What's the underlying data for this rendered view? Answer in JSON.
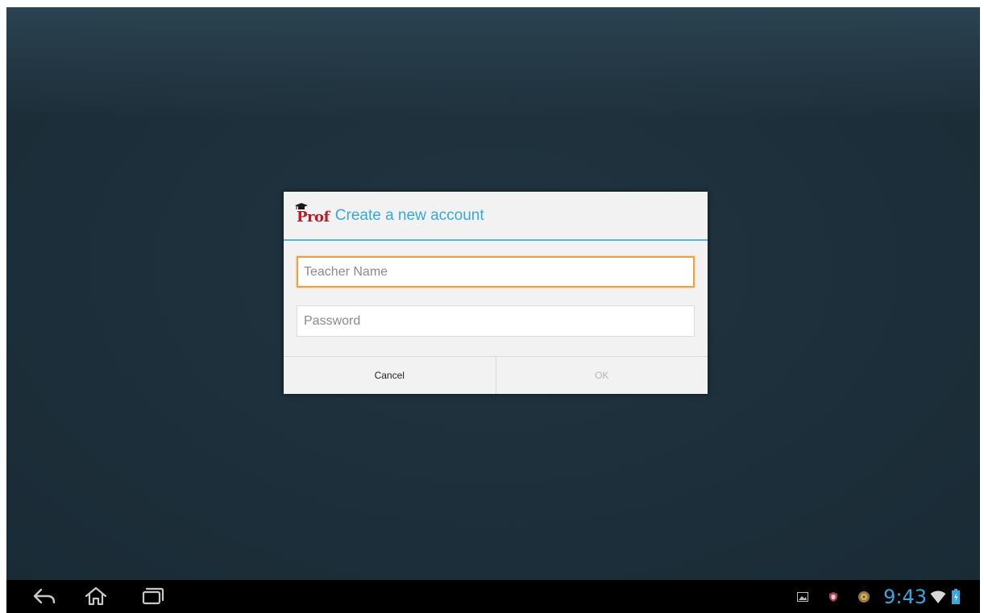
{
  "dialog": {
    "logo_text": "Prof",
    "title": "Create a new account",
    "teacher_name": {
      "value": "",
      "placeholder": "Teacher Name"
    },
    "password": {
      "value": "",
      "placeholder": "Password"
    },
    "cancel_label": "Cancel",
    "ok_label": "OK"
  },
  "navigation": {
    "icons": [
      "back-icon",
      "home-icon",
      "recent-apps-icon"
    ]
  },
  "status_bar": {
    "notifications": [
      "gallery-icon",
      "shield-icon",
      "app-notification-icon"
    ],
    "time": "9:43",
    "icons": [
      "wifi-icon",
      "battery-icon"
    ]
  },
  "colors": {
    "accent": "#38a8d8",
    "brand": "#b81d22",
    "focus": "#f0a040",
    "background": "#1f313d"
  }
}
